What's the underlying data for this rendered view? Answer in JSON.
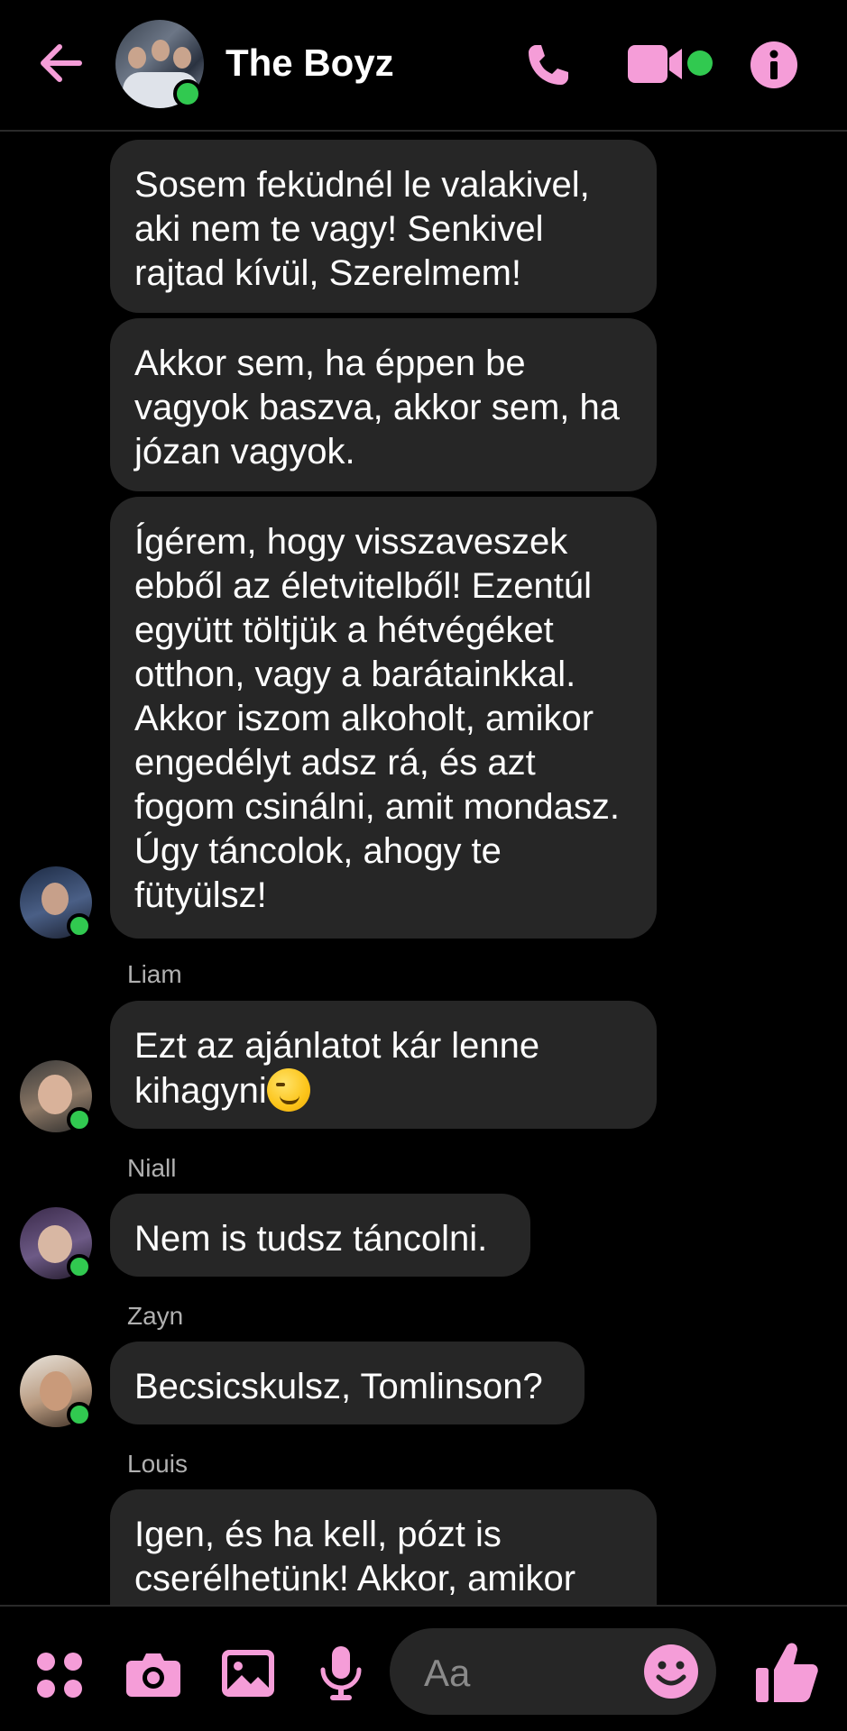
{
  "header": {
    "title": "The Boyz",
    "back_icon": "arrow-left-icon",
    "call_icon": "phone-icon",
    "video_icon": "video-camera-icon",
    "info_icon": "info-icon",
    "accent_color": "#f59dd8",
    "online_color": "#31c950"
  },
  "messages": [
    {
      "sender": "",
      "text": "Sosem feküdnél le valakivel, aki nem te vagy! Senkivel rajtad kívül, Szerelmem!"
    },
    {
      "sender": "",
      "text": "Akkor sem, ha éppen be vagyok baszva, akkor sem, ha józan vagyok."
    },
    {
      "sender": "",
      "text": "Ígérem, hogy visszaveszek ebből az életvitelből! Ezentúl együtt töltjük a hétvégéket otthon, vagy a barátainkkal. Akkor iszom alkoholt, amikor engedélyt adsz rá, és azt fogom csinálni, amit mondasz. Úgy táncolok, ahogy te fütyülsz!"
    },
    {
      "sender": "Liam",
      "text": "Ezt az ajánlatot kár lenne kihagyni"
    },
    {
      "sender": "Niall",
      "text": "Nem is tudsz táncolni."
    },
    {
      "sender": "Zayn",
      "text": "Becsicskulsz, Tomlinson?"
    },
    {
      "sender": "Louis",
      "text": "Igen, és ha kell, pózt is cserélhetünk! Akkor, amikor"
    }
  ],
  "footer": {
    "input_placeholder": "Aa",
    "menu_icon": "four-dots-menu-icon",
    "camera_icon": "camera-icon",
    "gallery_icon": "image-icon",
    "mic_icon": "microphone-icon",
    "emoji_icon": "smiley-icon",
    "like_icon": "thumbs-up-icon"
  }
}
